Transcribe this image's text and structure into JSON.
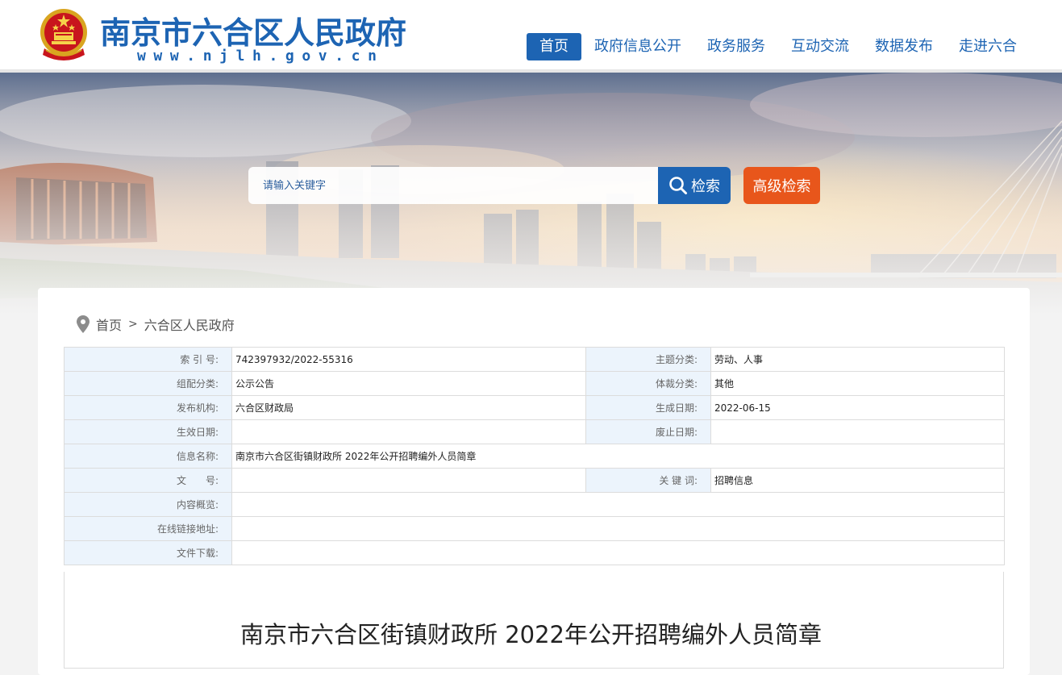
{
  "header": {
    "site_title": "南京市六合区人民政府",
    "site_url": "www.njlh.gov.cn",
    "nav": [
      {
        "label": "首页",
        "active": true
      },
      {
        "label": "政府信息公开",
        "active": false
      },
      {
        "label": "政务服务",
        "active": false
      },
      {
        "label": "互动交流",
        "active": false
      },
      {
        "label": "数据发布",
        "active": false
      },
      {
        "label": "走进六合",
        "active": false
      }
    ]
  },
  "search": {
    "placeholder": "请输入关键字",
    "button_label": "检索",
    "advanced_label": "高级检索"
  },
  "breadcrumb": {
    "home": "首页",
    "separator": ">",
    "current": "六合区人民政府"
  },
  "info": {
    "index_label": "索 引 号:",
    "index_value": "742397932/2022-55316",
    "topic_label": "主题分类:",
    "topic_value": "劳动、人事",
    "org_cat_label": "组配分类:",
    "org_cat_value": "公示公告",
    "genre_label": "体裁分类:",
    "genre_value": "其他",
    "publisher_label": "发布机构:",
    "publisher_value": "六合区财政局",
    "created_label": "生成日期:",
    "created_value": "2022-06-15",
    "effective_label": "生效日期:",
    "effective_value": "",
    "abolish_label": "废止日期:",
    "abolish_value": "",
    "name_label": "信息名称:",
    "name_value": "南京市六合区街镇财政所 2022年公开招聘编外人员简章",
    "docno_label": "文　　号:",
    "docno_value": "",
    "keywords_label": "关 键 词:",
    "keywords_value": "招聘信息",
    "summary_label": "内容概览:",
    "summary_value": "",
    "link_label": "在线链接地址:",
    "link_value": "",
    "download_label": "文件下载:",
    "download_value": ""
  },
  "document": {
    "title": "南京市六合区街镇财政所 2022年公开招聘编外人员简章"
  },
  "colors": {
    "brand_blue": "#1d64b3",
    "accent_orange": "#e8561b",
    "label_bg": "#ecf4fc"
  },
  "icons": [
    "national-emblem-icon",
    "search-icon",
    "location-pin-icon"
  ]
}
